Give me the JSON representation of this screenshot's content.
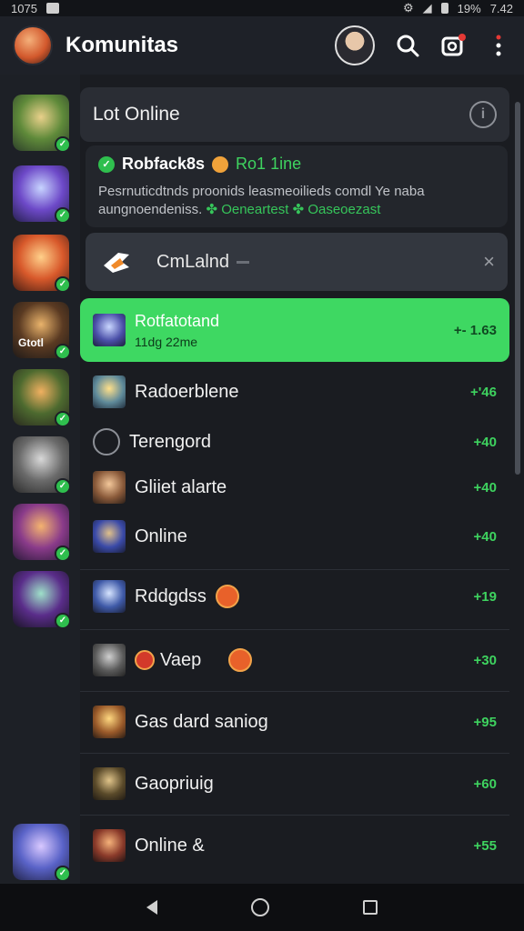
{
  "status_bar": {
    "time_left": "1075",
    "battery": "19%",
    "time_right": "7.42"
  },
  "appbar": {
    "title": "Komunitas",
    "icons": [
      "search-icon",
      "camera-icon",
      "more-vert-icon"
    ]
  },
  "online_card": {
    "title": "Lot Online",
    "icon": "info-icon"
  },
  "notice": {
    "name": "Robfack8s",
    "status": "Ro1 1ine",
    "line1": "Pesrnuticdtnds proonids leasmeoilieds comdl Ye naba",
    "line2_prefix": "aungnoendeniss.",
    "line2_green1": "Oeneartest",
    "line2_green2": "Oaseoezast"
  },
  "search": {
    "value": "CmLalnd",
    "clear": "×"
  },
  "channels": [
    {
      "label": "Rotfatotand",
      "sub": "11dg 22me",
      "count": "+- 1.63",
      "active": true
    },
    {
      "label": "Radoerblene",
      "count": "+'46"
    },
    {
      "label": "Terengord",
      "count": "+40"
    },
    {
      "label": "Gliiet alarte",
      "count": "+40"
    },
    {
      "label": "Online",
      "count": "+40"
    },
    {
      "label": "Rddgdss",
      "count": "+19"
    },
    {
      "label": "Vaep",
      "count": "+30"
    },
    {
      "label": "Gas dard saniog",
      "count": "+95"
    },
    {
      "label": "Gaopriuig",
      "count": "+60"
    },
    {
      "label": "Online &",
      "count": "+55"
    }
  ],
  "sidebar_avatar_label": "Gtotl",
  "colors": {
    "accent": "#3ed862",
    "background": "#1a1c21",
    "online": "#2fbf4e"
  }
}
